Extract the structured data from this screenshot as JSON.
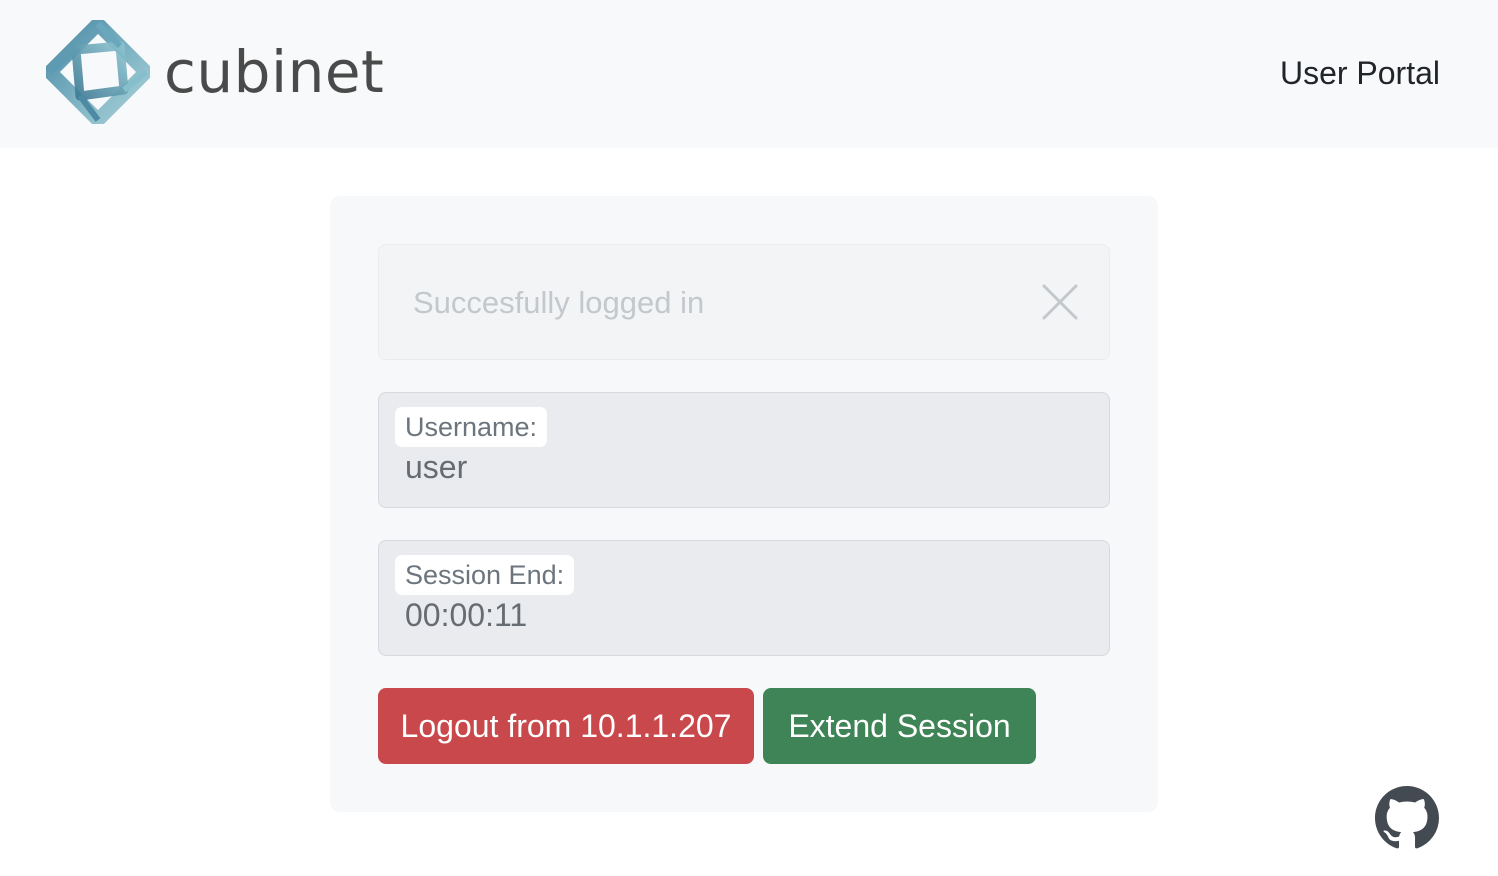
{
  "header": {
    "brand": "cubinet",
    "nav_title": "User Portal"
  },
  "alert": {
    "message": "Succesfully logged in",
    "close_icon": "close-icon"
  },
  "fields": {
    "username_label": "Username:",
    "username_value": "user",
    "session_label": "Session End:",
    "session_value": "00:00:11"
  },
  "buttons": {
    "logout_label": "Logout from 10.1.1.207",
    "extend_label": "Extend Session"
  },
  "footer": {
    "github_icon": "github-icon"
  },
  "colors": {
    "logout": "#c9484b",
    "extend": "#3f8456",
    "navbar_bg": "#f8f9fa",
    "logo_dark": "#3f7f99",
    "logo_light": "#9fcfd8"
  }
}
